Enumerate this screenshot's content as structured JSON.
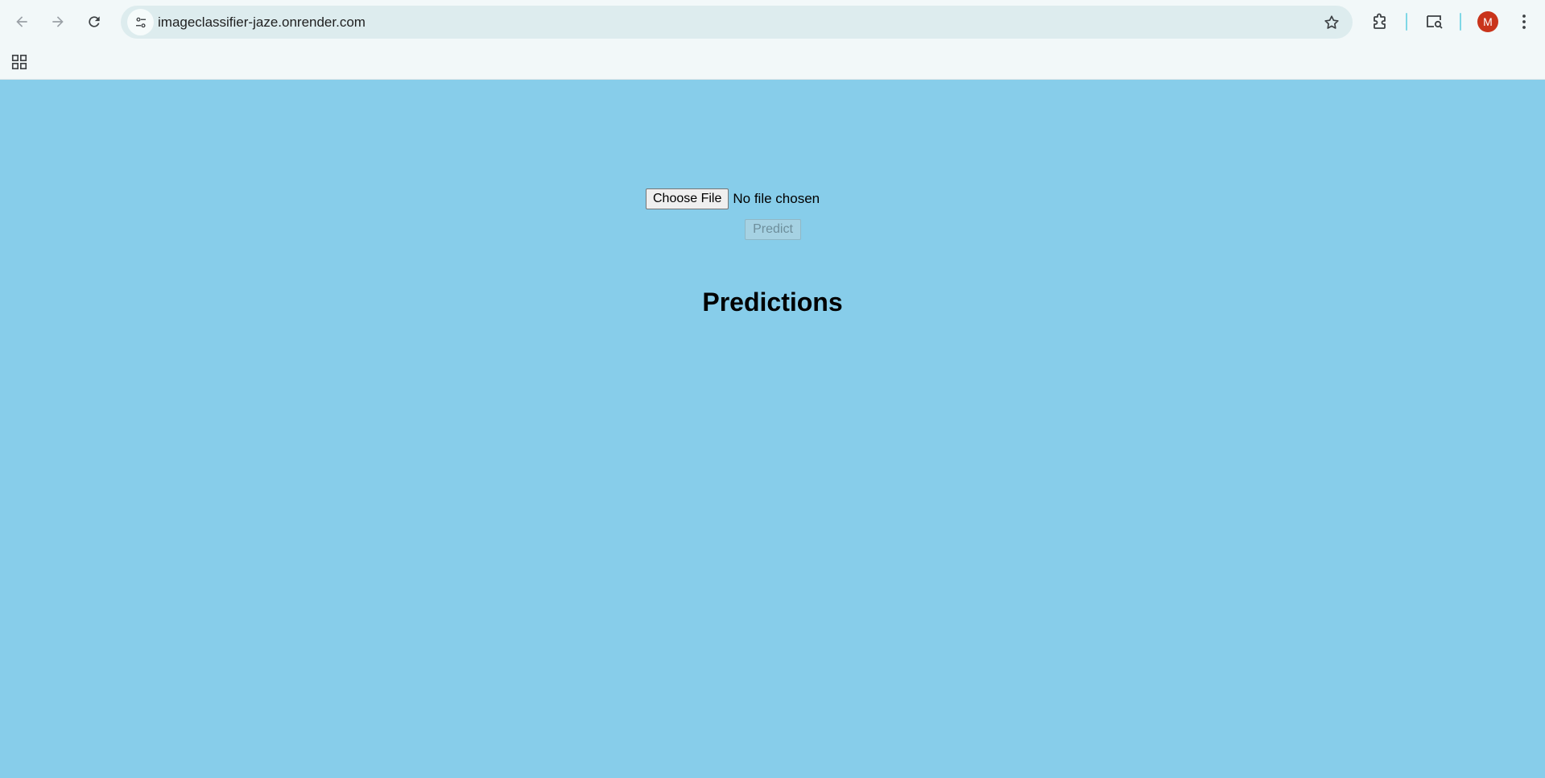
{
  "browser": {
    "url": "imageclassifier-jaze.onrender.com",
    "avatar_letter": "M",
    "avatar_color": "#C9341B",
    "icons": {
      "back": "back-arrow-icon",
      "forward": "forward-arrow-icon",
      "reload": "reload-icon",
      "site_info": "tune-icon",
      "bookmark": "star-icon",
      "extensions": "puzzle-icon",
      "media": "search-media-icon",
      "menu": "kebab-menu-icon",
      "apps": "apps-grid-icon"
    }
  },
  "page": {
    "background_color": "#87CDEA",
    "choose_file_label": "Choose File",
    "file_status": "No file chosen",
    "predict_label": "Predict",
    "heading": "Predictions"
  }
}
